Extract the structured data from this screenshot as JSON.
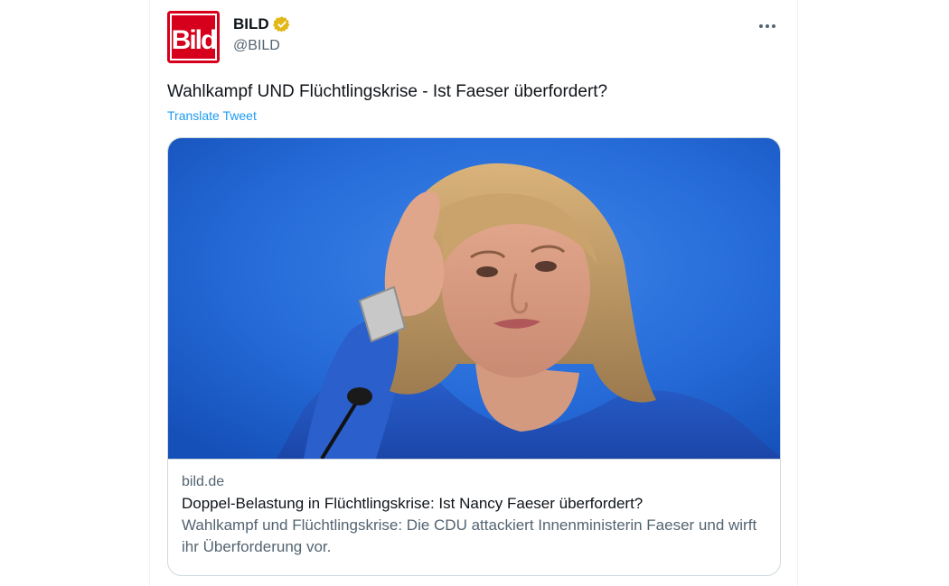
{
  "tweet": {
    "author": {
      "name": "BILD",
      "handle": "@BILD",
      "avatar_text": "Bild",
      "verified_color": "#e2b719"
    },
    "text": "Wahlkampf UND Flüchtlingskrise - Ist Faeser überfordert?",
    "translate_label": "Translate Tweet",
    "more_icon": "more-horizontal-icon"
  },
  "card": {
    "domain": "bild.de",
    "title": "Doppel-Belastung in Flüchtlingskrise: Ist Nancy Faeser überfordert?",
    "description": "Wahlkampf und Flüchtlingskrise: Die CDU attackiert Innenministerin Faeser und wirft ihr Überforderung vor."
  },
  "colors": {
    "brand_red": "#d6001c",
    "link_blue": "#1d9bf0",
    "photo_background": "#1f6bd6"
  }
}
